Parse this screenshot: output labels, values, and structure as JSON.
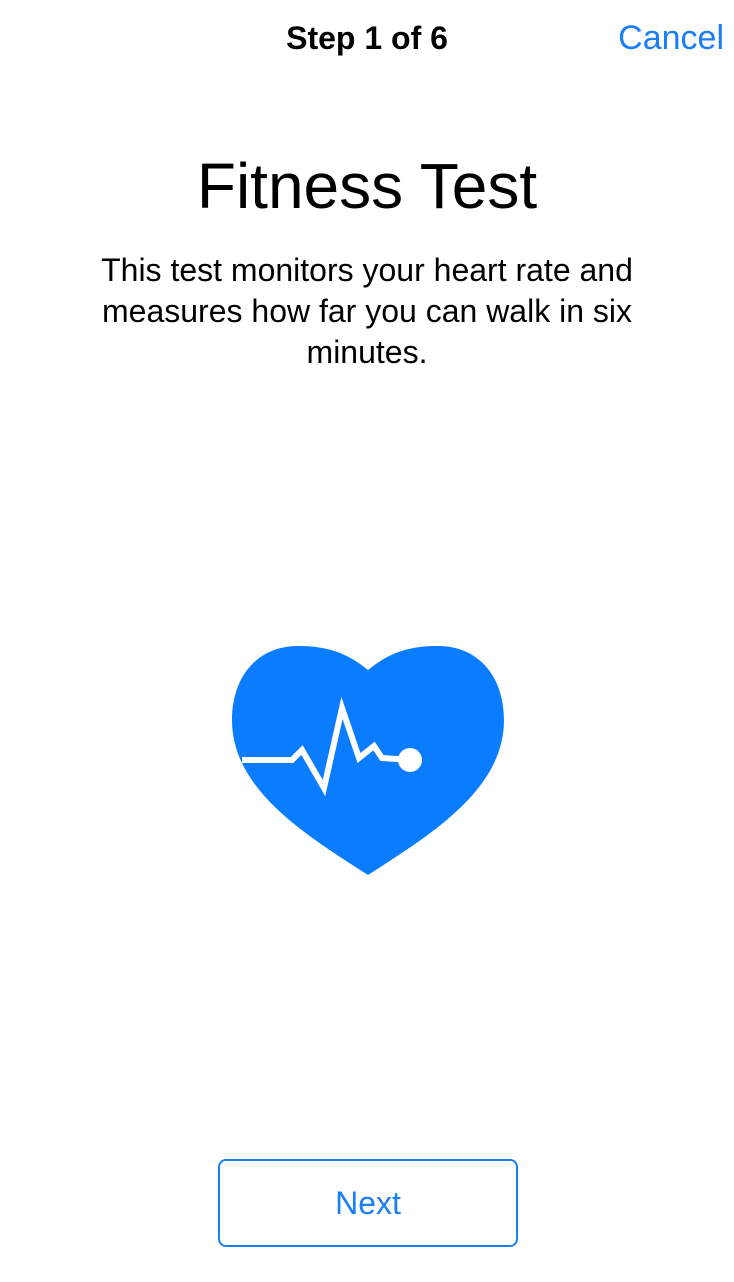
{
  "nav": {
    "step_label": "Step 1 of 6",
    "cancel_label": "Cancel"
  },
  "content": {
    "title": "Fitness Test",
    "description": "This test monitors your heart rate and measures how far you can walk in six minutes.",
    "illustration_icon": "heart-rate-icon"
  },
  "footer": {
    "next_label": "Next"
  },
  "colors": {
    "accent": "#1a7ef7",
    "heart_fill": "#0a7cff",
    "background": "#ffffff",
    "text": "#000000"
  }
}
